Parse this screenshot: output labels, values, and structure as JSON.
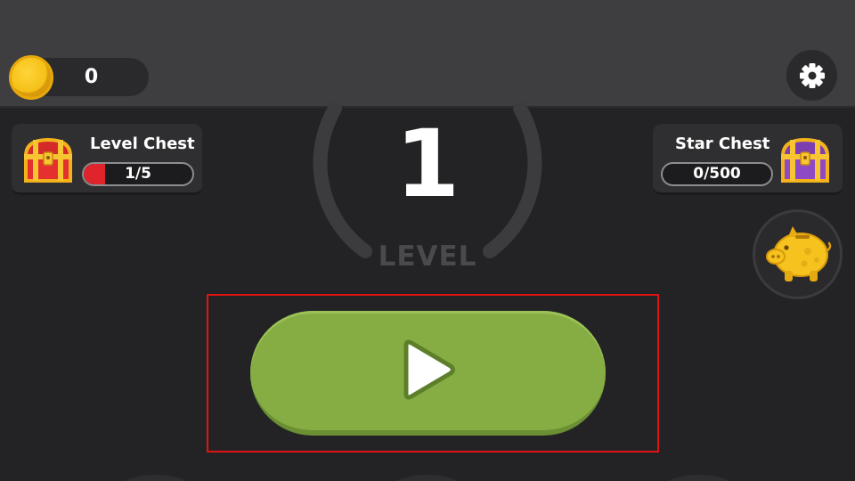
{
  "currency": {
    "coins": "0",
    "icon": "coin-icon"
  },
  "header": {
    "settings_icon": "gear-icon"
  },
  "level_chest": {
    "title": "Level Chest",
    "progress_text": "1/5",
    "progress": 0.2,
    "icon": "red-chest-icon",
    "fill_color": "#e0242c"
  },
  "star_chest": {
    "title": "Star Chest",
    "progress_text": "0/500",
    "progress": 0,
    "icon": "purple-chest-icon"
  },
  "level": {
    "number": "1",
    "label": "LEVEL"
  },
  "piggy_bank": {
    "icon": "piggy-bank-icon"
  },
  "play": {
    "icon": "play-icon",
    "color": "#86ad43"
  },
  "colors": {
    "background": "#232325",
    "topbar": "#3e3e40",
    "accent_red": "#e0242c",
    "play_green": "#86ad43"
  }
}
